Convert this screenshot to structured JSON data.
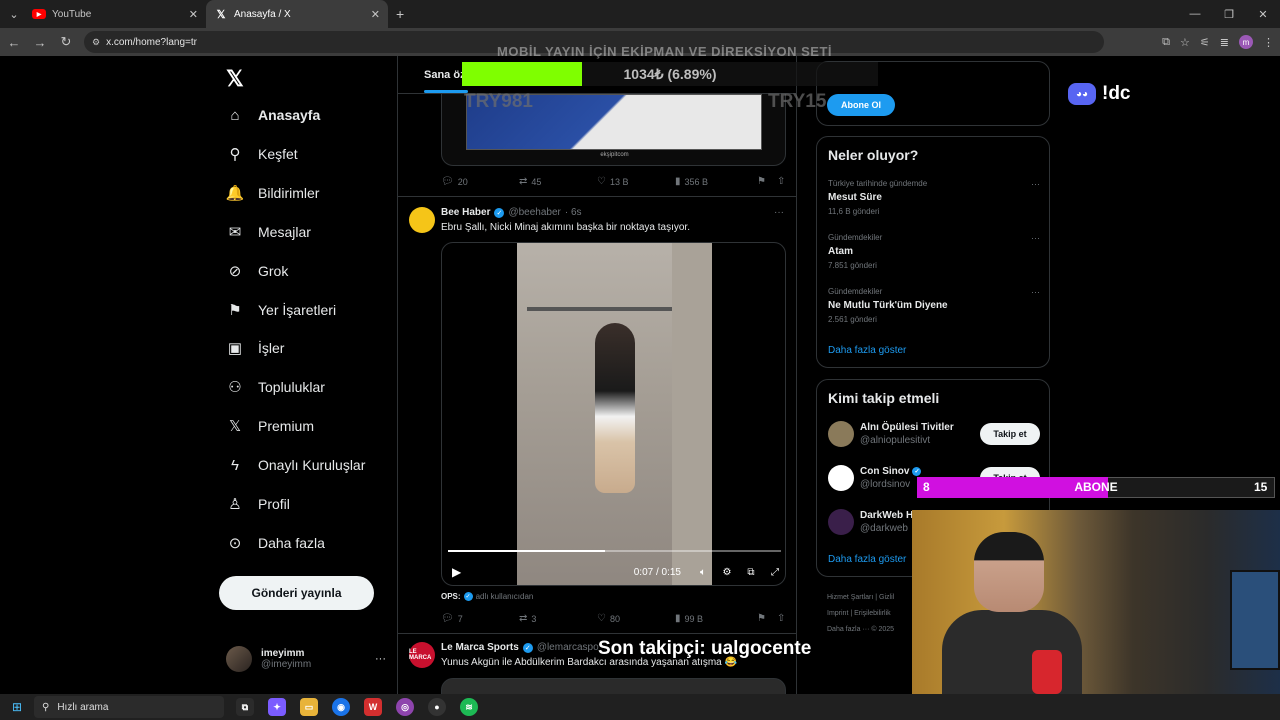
{
  "browser": {
    "tabs": [
      {
        "label": "YouTube",
        "icon": "youtube-icon"
      },
      {
        "label": "Anasayfa / X",
        "icon": "x-logo-icon"
      }
    ],
    "url": "x.com/home?lang=tr"
  },
  "nav": {
    "items": [
      {
        "label": "Anasayfa",
        "icon": "home-icon",
        "glyph": "⌂"
      },
      {
        "label": "Keşfet",
        "icon": "search-icon",
        "glyph": "⚲"
      },
      {
        "label": "Bildirimler",
        "icon": "bell-icon",
        "glyph": "🔔"
      },
      {
        "label": "Mesajlar",
        "icon": "mail-icon",
        "glyph": "✉"
      },
      {
        "label": "Grok",
        "icon": "grok-icon",
        "glyph": "⊘"
      },
      {
        "label": "Yer İşaretleri",
        "icon": "bookmark-icon",
        "glyph": "⚑"
      },
      {
        "label": "İşler",
        "icon": "briefcase-icon",
        "glyph": "▣"
      },
      {
        "label": "Topluluklar",
        "icon": "communities-icon",
        "glyph": "⚇"
      },
      {
        "label": "Premium",
        "icon": "x-premium-icon",
        "glyph": "𝕏"
      },
      {
        "label": "Onaylı Kuruluşlar",
        "icon": "lightning-icon",
        "glyph": "ϟ"
      },
      {
        "label": "Profil",
        "icon": "profile-icon",
        "glyph": "♙"
      },
      {
        "label": "Daha fazla",
        "icon": "more-circle-icon",
        "glyph": "⊙"
      }
    ],
    "post_button": "Gönderi yayınla",
    "account": {
      "name": "imeyimm",
      "handle": "@imeyimm"
    }
  },
  "feed": {
    "tab": "Sana öz",
    "prev_tweet": {
      "replies": "20",
      "reposts": "45",
      "likes": "13 B",
      "views": "356 B",
      "site": "ekşipitcom"
    },
    "tweet1": {
      "name": "Bee Haber",
      "handle": "@beehaber",
      "time": "· 6s",
      "text": "Ebru Şallı, Nicki Minaj akımını başka bir noktaya taşıyor.",
      "video_time": "0:07 / 0:15",
      "video_progress": 0.47,
      "ops_label": "OPS:",
      "ops_text": "adlı kullanıcıdan",
      "replies": "7",
      "reposts": "3",
      "likes": "80",
      "views": "99 B"
    },
    "tweet2": {
      "name": "Le Marca Sports",
      "handle": "@lemarcaspo",
      "avatar_text": "LE MARCA",
      "text": "Yunus Akgün ile Abdülkerim Bardakcı arasında yaşanan atışma 😂"
    }
  },
  "sidebar": {
    "abone_button": "Abone Ol",
    "trends_title": "Neler oluyor?",
    "trends": [
      {
        "context": "Türkiye tarihinde gündemde",
        "title": "Mesut Süre",
        "count": "11,6 B gönderi"
      },
      {
        "context": "Gündemdekiler",
        "title": "Atam",
        "count": "7.851 gönderi"
      },
      {
        "context": "Gündemdekiler",
        "title": "Ne Mutlu Türk'üm Diyene",
        "count": "2.561 gönderi"
      }
    ],
    "show_more": "Daha fazla göster",
    "who_title": "Kimi takip etmeli",
    "who": [
      {
        "name": "Alnı Öpülesi Tivitler",
        "handle": "@alniopulesitivt",
        "verified": false
      },
      {
        "name": "Con Sinov",
        "handle": "@lordsinov",
        "verified": true
      },
      {
        "name": "DarkWeb Haber",
        "handle": "@darkweb",
        "verified": true
      }
    ],
    "follow_label": "Takip et",
    "footer": [
      "Hizmet Şartları |",
      "Gizlil",
      "Imprint |",
      "Erişilebilirlik",
      "Daha fazla ··· © 2025"
    ]
  },
  "overlay": {
    "title": "MOBİL YAYIN İÇİN EKİPMAN VE DİREKSİYON SETİ",
    "goal_text": "1034₺ (6.89%)",
    "goal_fraction": 0.0689,
    "try_left": "TRY981",
    "try_right": "TRY15",
    "discord": "!dc",
    "sub_current": "8",
    "sub_label": "ABONE",
    "sub_target": "15",
    "sub_fraction": 0.5333,
    "last_follower": "Son takipçi: ualgocente"
  },
  "taskbar": {
    "search": "Hızlı arama"
  },
  "colors": {
    "accent": "#1d9bf0",
    "goal": "#7fff00",
    "sub": "#d010e0"
  }
}
